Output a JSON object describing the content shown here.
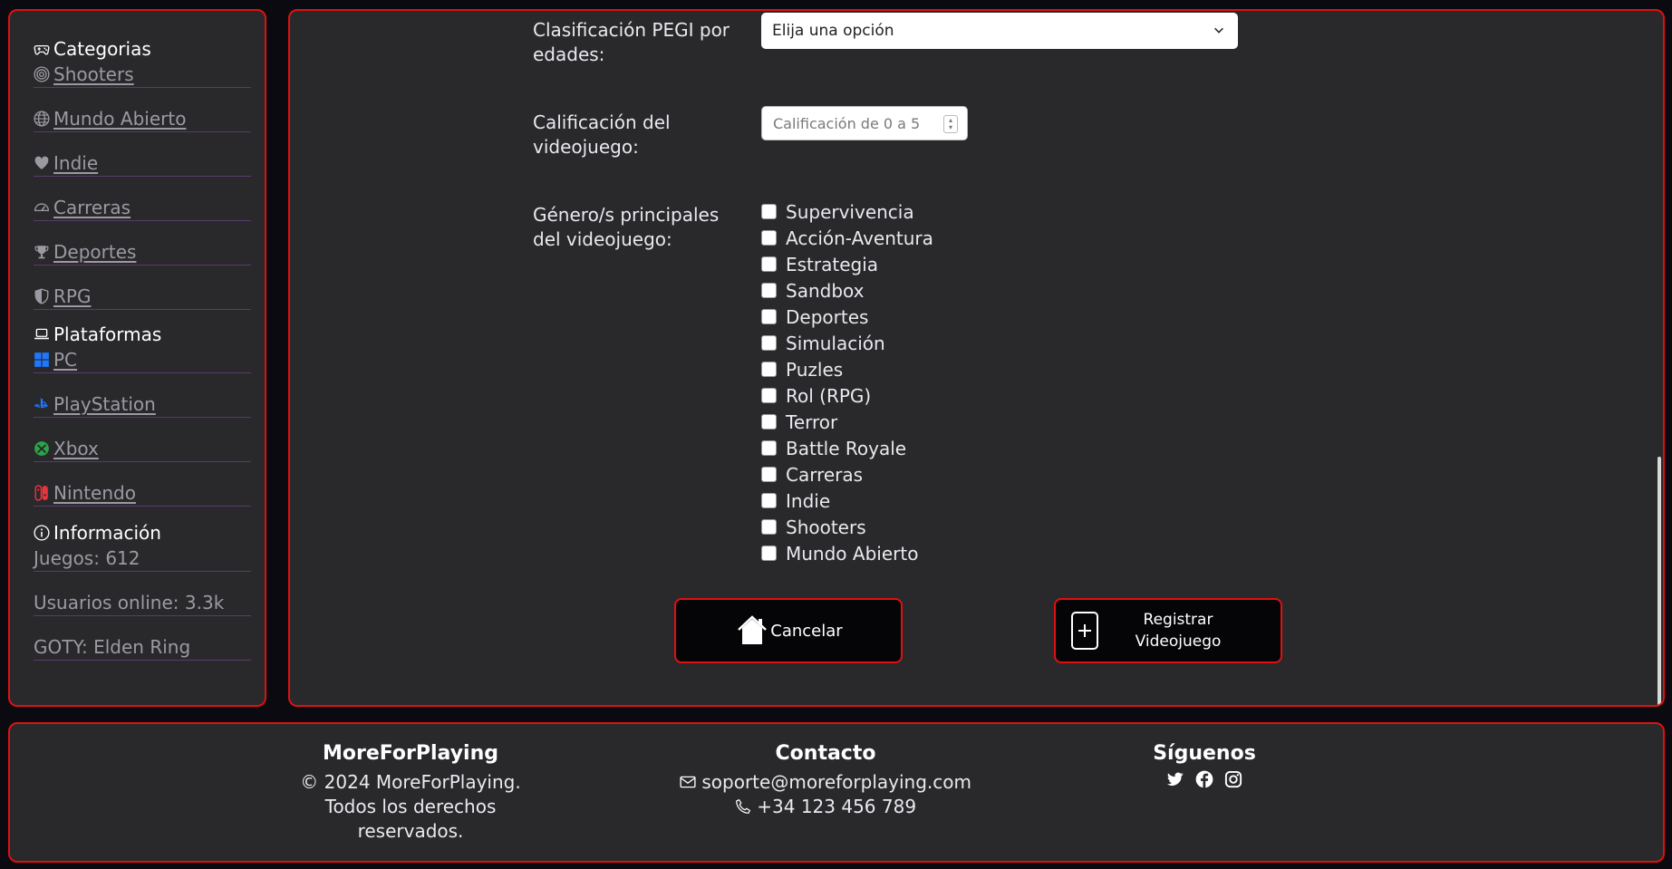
{
  "sidebar": {
    "categories_header": "Categorias",
    "categories": [
      "Shooters",
      "Mundo Abierto",
      "Indie",
      "Carreras",
      "Deportes",
      "RPG"
    ],
    "platforms_header": "Plataformas",
    "platforms": [
      "PC",
      "PlayStation",
      "Xbox",
      "Nintendo"
    ],
    "info_header": "Información",
    "info": [
      "Juegos: 612",
      "Usuarios online: 3.3k",
      "GOTY: Elden Ring"
    ]
  },
  "form": {
    "pegi_label": "Clasificación PEGI por edades:",
    "pegi_value": "Elija una opción",
    "rating_label": "Calificación del videojuego:",
    "rating_placeholder": "Calificación de 0 a 5",
    "genres_label": "Género/s principales del videojuego:",
    "genres": [
      "Supervivencia",
      "Acción-Aventura",
      "Estrategia",
      "Sandbox",
      "Deportes",
      "Simulación",
      "Puzles",
      "Rol (RPG)",
      "Terror",
      "Battle Royale",
      "Carreras",
      "Indie",
      "Shooters",
      "Mundo Abierto"
    ],
    "cancel_label": "Cancelar",
    "register_label": "Registrar Videojuego"
  },
  "footer": {
    "brand_title": "MoreForPlaying",
    "copyright": "© 2024 MoreForPlaying. Todos los derechos reservados.",
    "contact_title": "Contacto",
    "email": "soporte@moreforplaying.com",
    "phone": "+34 123 456 789",
    "follow_title": "Síguenos"
  },
  "colors": {
    "accent": "#e01010",
    "panel": "#29292c",
    "background": "#0a0a10"
  }
}
